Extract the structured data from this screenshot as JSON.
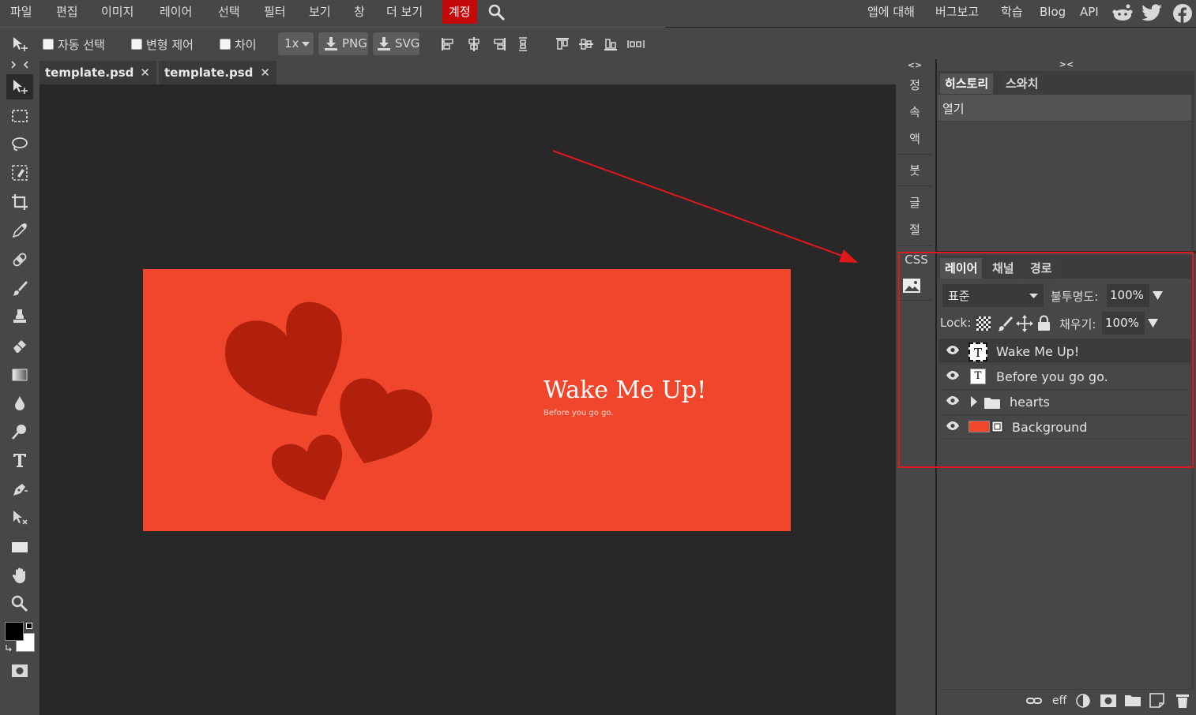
{
  "menubar": {
    "items": [
      "파일",
      "편집",
      "이미지",
      "레이어",
      "선택",
      "필터",
      "보기",
      "창",
      "더 보기"
    ],
    "account": "계정",
    "right_links": [
      "앱에 대해",
      "버그보고",
      "학습",
      "Blog",
      "API"
    ]
  },
  "options": {
    "auto_select": "자동 선택",
    "transform": "변형 제어",
    "distance": "차이",
    "zoom_value": "1x",
    "png": "PNG",
    "svg": "SVG"
  },
  "tabs": [
    {
      "label": "template.psd",
      "close": "✕"
    },
    {
      "label": "template.psd",
      "close": "✕"
    }
  ],
  "canvas": {
    "title": "Wake Me Up!",
    "subtitle": "Before you go go.",
    "bg_color": "#f0472c",
    "heart_color": "#b1200c"
  },
  "strip": {
    "toggle": "<>",
    "items": [
      "정",
      "속",
      "액",
      "붓",
      "글",
      "절"
    ],
    "css": "CSS"
  },
  "history_panel": {
    "toggle": "><",
    "tabs": [
      "히스토리",
      "스와치"
    ],
    "entries": [
      "열기"
    ]
  },
  "layers_panel": {
    "tabs": [
      "레이어",
      "채널",
      "경로"
    ],
    "blend_mode": "표준",
    "opacity_label": "불투명도:",
    "opacity_value": "100%",
    "lock_label": "Lock:",
    "fill_label": "채우기:",
    "fill_value": "100%",
    "layers": [
      {
        "name": "Wake Me Up!",
        "kind": "text",
        "selected": true
      },
      {
        "name": "Before you go go.",
        "kind": "text",
        "selected": false
      },
      {
        "name": "hearts",
        "kind": "folder",
        "selected": false
      },
      {
        "name": "Background",
        "kind": "image",
        "selected": false
      }
    ],
    "footer": {
      "eff": "eff"
    }
  },
  "colors": {
    "accent_red": "#c4090b",
    "annotation": "#e0181b",
    "foreground": "#000000",
    "background": "#ffffff"
  }
}
